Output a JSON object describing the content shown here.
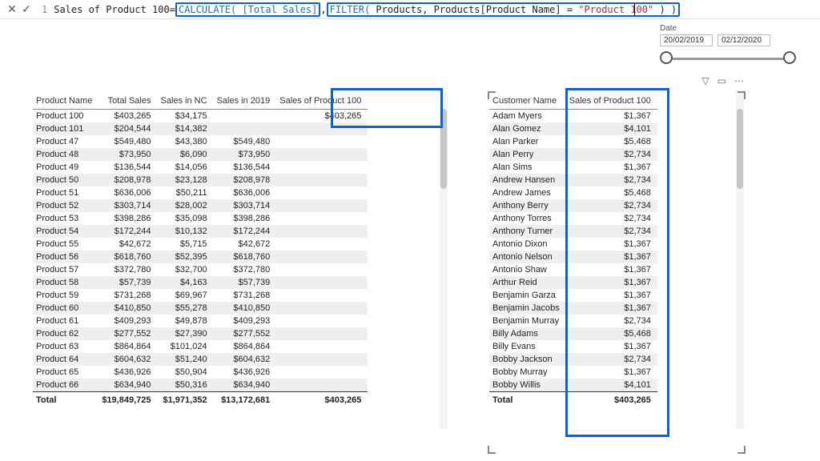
{
  "formula": {
    "lineno": "1",
    "measure": "Sales of Product 100",
    "eq": " = ",
    "fn1": "CALCULATE(",
    "arg1": " [Total Sales]",
    "comma1": ", ",
    "filter_kw": "FILTER(",
    "filter_arg1": " Products, Products[Product Name]",
    "filter_eq": " = ",
    "filter_val": "\"Product 100\"",
    "filter_close": " ) )"
  },
  "date": {
    "label": "Date",
    "from": "20/02/2019",
    "to": "02/12/2020"
  },
  "table1": {
    "headers": [
      "Product Name",
      "Total Sales",
      "Sales in NC",
      "Sales in 2019",
      "Sales of Product 100"
    ],
    "rows": [
      [
        "Product 100",
        "$403,265",
        "$34,175",
        "",
        "$403,265"
      ],
      [
        "Product 101",
        "$204,544",
        "$14,382",
        "",
        ""
      ],
      [
        "Product 47",
        "$549,480",
        "$43,380",
        "$549,480",
        ""
      ],
      [
        "Product 48",
        "$73,950",
        "$6,090",
        "$73,950",
        ""
      ],
      [
        "Product 49",
        "$136,544",
        "$14,056",
        "$136,544",
        ""
      ],
      [
        "Product 50",
        "$208,978",
        "$23,128",
        "$208,978",
        ""
      ],
      [
        "Product 51",
        "$636,006",
        "$50,211",
        "$636,006",
        ""
      ],
      [
        "Product 52",
        "$303,714",
        "$28,002",
        "$303,714",
        ""
      ],
      [
        "Product 53",
        "$398,286",
        "$35,098",
        "$398,286",
        ""
      ],
      [
        "Product 54",
        "$172,244",
        "$10,132",
        "$172,244",
        ""
      ],
      [
        "Product 55",
        "$42,672",
        "$5,715",
        "$42,672",
        ""
      ],
      [
        "Product 56",
        "$618,760",
        "$52,395",
        "$618,760",
        ""
      ],
      [
        "Product 57",
        "$372,780",
        "$32,700",
        "$372,780",
        ""
      ],
      [
        "Product 58",
        "$57,739",
        "$4,163",
        "$57,739",
        ""
      ],
      [
        "Product 59",
        "$731,268",
        "$69,967",
        "$731,268",
        ""
      ],
      [
        "Product 60",
        "$410,850",
        "$55,278",
        "$410,850",
        ""
      ],
      [
        "Product 61",
        "$409,293",
        "$49,878",
        "$409,293",
        ""
      ],
      [
        "Product 62",
        "$277,552",
        "$27,390",
        "$277,552",
        ""
      ],
      [
        "Product 63",
        "$864,864",
        "$101,024",
        "$864,864",
        ""
      ],
      [
        "Product 64",
        "$604,632",
        "$51,240",
        "$604,632",
        ""
      ],
      [
        "Product 65",
        "$436,926",
        "$50,904",
        "$436,926",
        ""
      ],
      [
        "Product 66",
        "$634,940",
        "$50,316",
        "$634,940",
        ""
      ]
    ],
    "totals": [
      "Total",
      "$19,849,725",
      "$1,971,352",
      "$13,172,681",
      "$403,265"
    ]
  },
  "table2": {
    "headers": [
      "Customer Name",
      "Sales of Product 100"
    ],
    "rows": [
      [
        "Adam Myers",
        "$1,367"
      ],
      [
        "Alan Gomez",
        "$4,101"
      ],
      [
        "Alan Parker",
        "$5,468"
      ],
      [
        "Alan Perry",
        "$2,734"
      ],
      [
        "Alan Sims",
        "$1,367"
      ],
      [
        "Andrew Hansen",
        "$2,734"
      ],
      [
        "Andrew James",
        "$5,468"
      ],
      [
        "Anthony Berry",
        "$2,734"
      ],
      [
        "Anthony Torres",
        "$2,734"
      ],
      [
        "Anthony Turner",
        "$2,734"
      ],
      [
        "Antonio Dixon",
        "$1,367"
      ],
      [
        "Antonio Nelson",
        "$1,367"
      ],
      [
        "Antonio Shaw",
        "$1,367"
      ],
      [
        "Arthur Reid",
        "$1,367"
      ],
      [
        "Benjamin Garza",
        "$1,367"
      ],
      [
        "Benjamin Jacobs",
        "$1,367"
      ],
      [
        "Benjamin Murray",
        "$2,734"
      ],
      [
        "Billy Adams",
        "$5,468"
      ],
      [
        "Billy Evans",
        "$1,367"
      ],
      [
        "Bobby Jackson",
        "$2,734"
      ],
      [
        "Bobby Murray",
        "$1,367"
      ],
      [
        "Bobby Willis",
        "$4,101"
      ]
    ],
    "totals": [
      "Total",
      "$403,265"
    ]
  }
}
